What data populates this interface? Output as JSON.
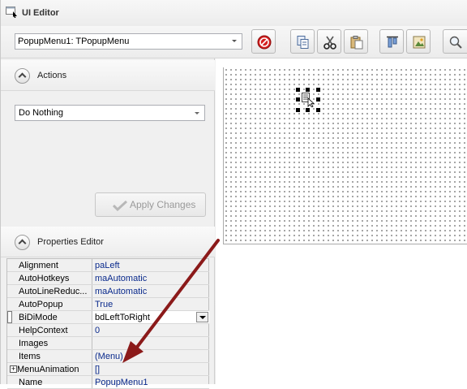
{
  "window": {
    "title": "UI Editor"
  },
  "toolbar": {
    "component_select": "PopupMenu1: TPopupMenu",
    "buttons": [
      "delete-icon",
      "copy-icon",
      "cut-icon",
      "paste-icon",
      "align-icon",
      "image-icon",
      "search-icon"
    ]
  },
  "actions": {
    "header": "Actions",
    "selected_action": "Do Nothing",
    "apply_label": "Apply Changes"
  },
  "properties": {
    "header": "Properties Editor",
    "rows": [
      {
        "name": "Alignment",
        "value": "paLeft"
      },
      {
        "name": "AutoHotkeys",
        "value": "maAutomatic"
      },
      {
        "name": "AutoLineReduc...",
        "value": "maAutomatic"
      },
      {
        "name": "AutoPopup",
        "value": "True"
      },
      {
        "name": "BiDiMode",
        "value": "bdLeftToRight"
      },
      {
        "name": "HelpContext",
        "value": "0"
      },
      {
        "name": "Images",
        "value": ""
      },
      {
        "name": "Items",
        "value": "(Menu)"
      },
      {
        "name": "MenuAnimation",
        "value": "[]"
      },
      {
        "name": "Name",
        "value": "PopupMenu1"
      }
    ]
  },
  "colors": {
    "value_text": "#0a2a8c",
    "annotation_arrow": "#8b1a1a"
  }
}
